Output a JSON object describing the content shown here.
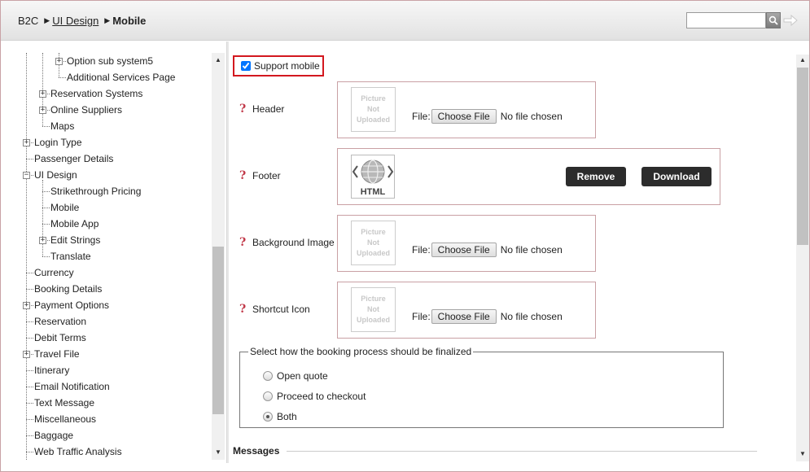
{
  "breadcrumb": {
    "root": "B2C",
    "parent": "UI Design",
    "current": "Mobile"
  },
  "search": {
    "placeholder": ""
  },
  "tree": {
    "items": [
      "Option sub system5",
      "Additional Services Page",
      "Reservation Systems",
      "Online Suppliers",
      "Maps",
      "Login Type",
      "Passenger Details",
      "UI Design",
      "Strikethrough Pricing",
      "Mobile",
      "Mobile App",
      "Edit Strings",
      "Translate",
      "Currency",
      "Booking Details",
      "Payment Options",
      "Reservation",
      "Debit Terms",
      "Travel File",
      "Itinerary",
      "Email Notification",
      "Text Message",
      "Miscellaneous",
      "Baggage",
      "Web Traffic Analysis"
    ]
  },
  "main": {
    "support_mobile": {
      "label": "Support mobile",
      "checked": true
    },
    "fields": {
      "header": "Header",
      "footer": "Footer",
      "background": "Background Image",
      "shortcut": "Shortcut Icon"
    },
    "placeholder_pic": [
      "Picture",
      "Not",
      "Uploaded"
    ],
    "file_label": "File:",
    "choose_file": "Choose File",
    "no_file": "No file chosen",
    "html_label": "HTML",
    "remove": "Remove",
    "download": "Download",
    "finalize": {
      "legend": "Select how the booking process should be finalized",
      "options": [
        "Open quote",
        "Proceed to checkout",
        "Both"
      ],
      "selected": "Both"
    },
    "messages": "Messages"
  }
}
